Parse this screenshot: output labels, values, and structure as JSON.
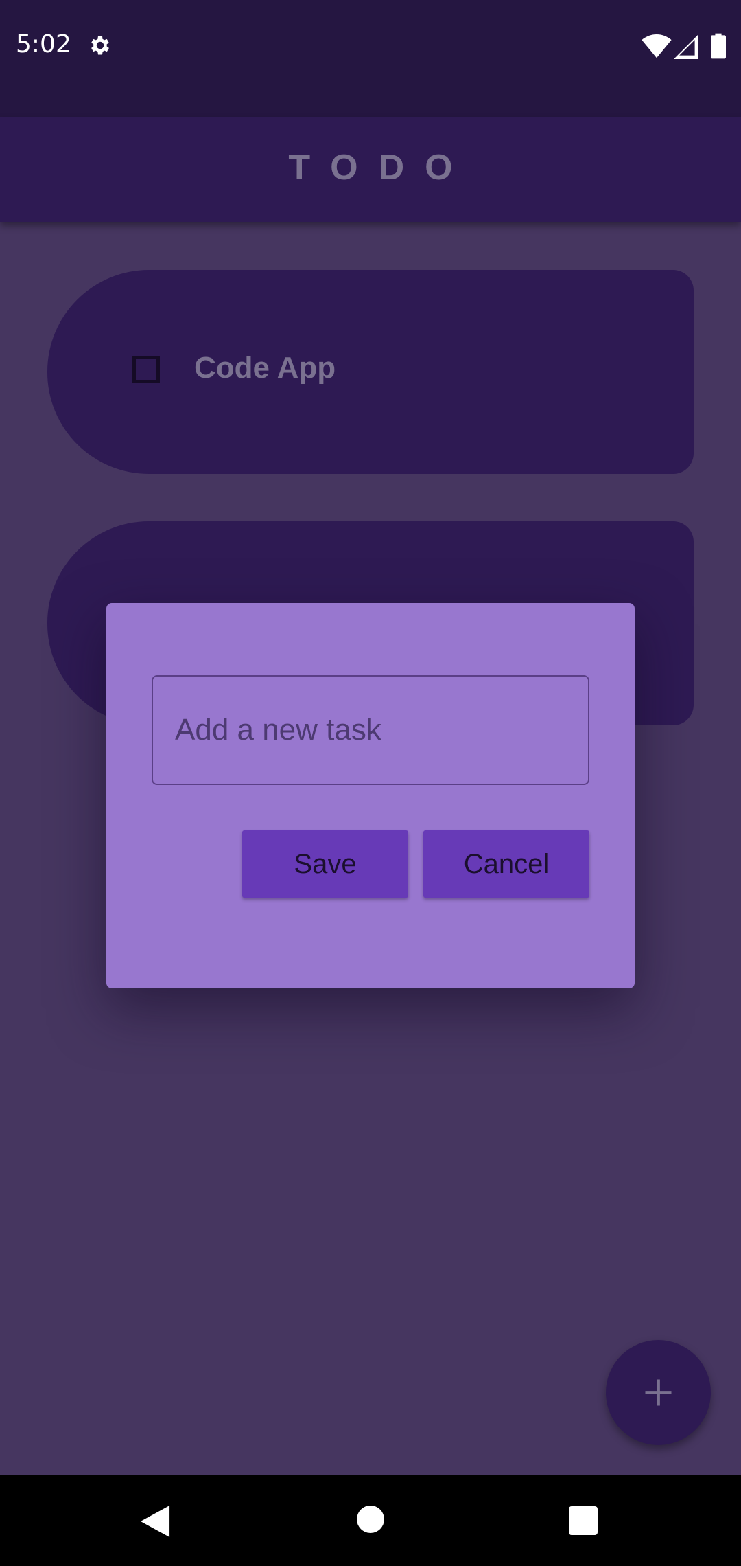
{
  "status_bar": {
    "time": "5:02",
    "icons": [
      "gear-icon",
      "wifi-icon",
      "signal-icon",
      "battery-icon"
    ]
  },
  "app_bar": {
    "title": "TODO"
  },
  "tasks": [
    {
      "label": "Code App",
      "checked": false
    },
    {
      "label": "",
      "checked": false
    }
  ],
  "dialog": {
    "input_placeholder": "Add a new task",
    "input_value": "",
    "save_label": "Save",
    "cancel_label": "Cancel"
  },
  "fab": {
    "icon": "plus-icon"
  },
  "nav_bar": {
    "icons": [
      "back-icon",
      "home-icon",
      "recents-icon"
    ]
  },
  "colors": {
    "background": "#463660",
    "surface": "#2e1a53",
    "dialog": "#9877cf",
    "button": "#673ab7",
    "status_bar": "#251641"
  }
}
